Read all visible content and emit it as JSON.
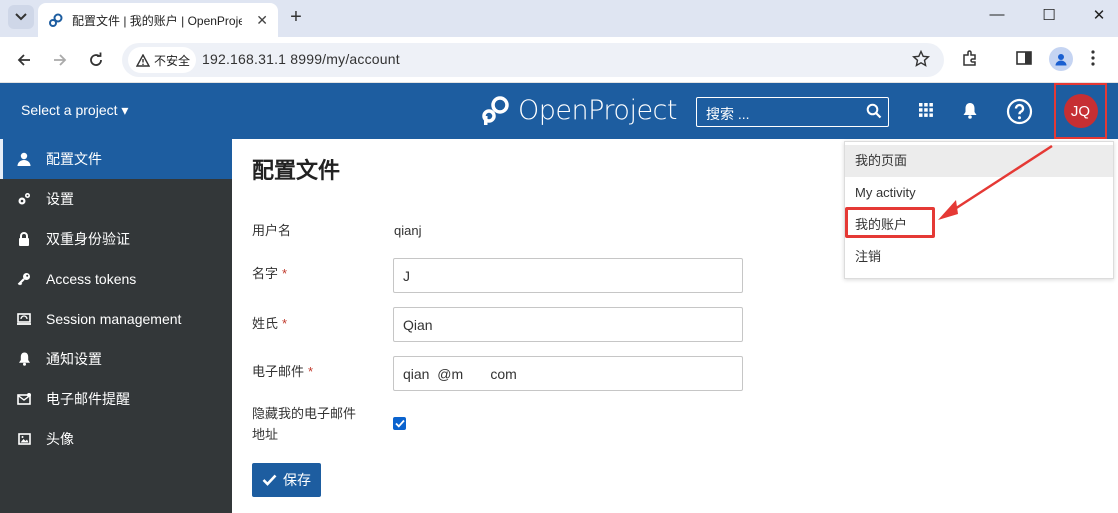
{
  "browser": {
    "tab_title": "配置文件 | 我的账户 | OpenProject",
    "tab_close": "✕",
    "new_tab": "+",
    "security_label": "不安全",
    "url": "192.168.31.1 8999/my/account",
    "window_controls": [
      "—",
      "☐",
      "✕"
    ]
  },
  "header": {
    "project_select": "Select a project ▾",
    "logo_text": "OpenProject",
    "search_placeholder": "搜索 ...",
    "avatar_initials": "JQ"
  },
  "sidebar": {
    "items": [
      {
        "label": "配置文件",
        "icon": "user-icon",
        "active": true
      },
      {
        "label": "设置",
        "icon": "gears-icon",
        "active": false
      },
      {
        "label": "双重身份验证",
        "icon": "lock-icon",
        "active": false
      },
      {
        "label": "Access tokens",
        "icon": "key-icon",
        "active": false
      },
      {
        "label": "Session management",
        "icon": "session-icon",
        "active": false
      },
      {
        "label": "通知设置",
        "icon": "bell-icon",
        "active": false
      },
      {
        "label": "电子邮件提醒",
        "icon": "mail-icon",
        "active": false
      },
      {
        "label": "头像",
        "icon": "image-icon",
        "active": false
      }
    ]
  },
  "main": {
    "title": "配置文件",
    "username_label": "用户名",
    "username_value": "qianj",
    "firstname_label": "名字",
    "firstname_value": "J",
    "lastname_label": "姓氏",
    "lastname_value": "Qian",
    "email_label": "电子邮件",
    "email_value": "qian  @m       com",
    "hide_email_label_line1": "隐藏我的电子邮件",
    "hide_email_label_line2": "地址",
    "hide_email_checked": true,
    "required_mark": "*",
    "save_label": "保存"
  },
  "user_menu": {
    "items": [
      "我的页面",
      "My activity",
      "我的账户",
      "注销"
    ]
  },
  "colors": {
    "header_blue": "#1d5da0",
    "sidebar_dark": "#333739",
    "avatar_red": "#c62f33",
    "annotation_red": "#e53935"
  }
}
